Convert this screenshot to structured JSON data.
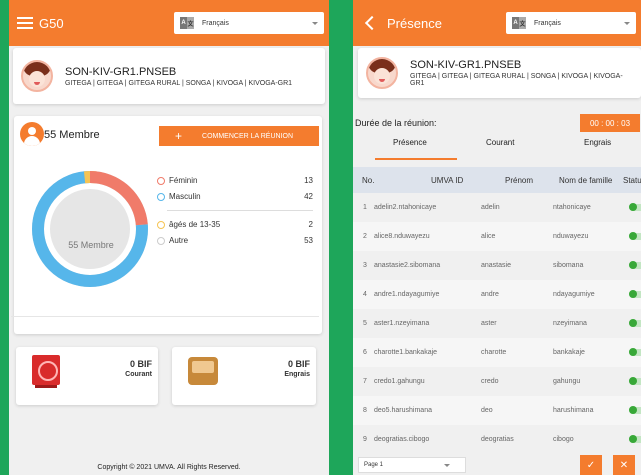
{
  "left": {
    "appbar_title": "G50",
    "language": "Français",
    "lang_badge": [
      "A",
      "文"
    ],
    "profile": {
      "name": "SON-KIV-GR1.PNSEB",
      "location": "GITEGA | GITEGA | GITEGA RURAL | SONGA | KIVOGA | KIVOGA-GR1"
    },
    "members": {
      "count_label": "55 Membre",
      "start_button": "COMMENCER LA RÉUNION",
      "plus": "+",
      "donut_center": "55 Membre",
      "legend": [
        {
          "label": "Féminin",
          "value": "13",
          "color": "#f07b6a"
        },
        {
          "label": "Masculin",
          "value": "42",
          "color": "#56b6ea"
        },
        {
          "label": "âgés de 13-35",
          "value": "2",
          "color": "#f6c453"
        },
        {
          "label": "Autre",
          "value": "53",
          "color": "#cccccc"
        }
      ]
    },
    "stats": [
      {
        "value": "0 BIF",
        "label": "Courant",
        "icon": "safe-icon"
      },
      {
        "value": "0 BIF",
        "label": "Engrais",
        "icon": "sack-icon"
      }
    ],
    "copyright": "Copyright © 2021 UMVA. All Rights Reserved."
  },
  "right": {
    "appbar_title": "Présence",
    "language": "Français",
    "lang_badge": [
      "A",
      "文"
    ],
    "profile": {
      "name": "SON-KIV-GR1.PNSEB",
      "location": "GITEGA | GITEGA | GITEGA RURAL | SONGA | KIVOGA | KIVOGA-GR1"
    },
    "meeting_label": "Durée de la réunion:",
    "timer": "00 : 00 : 03",
    "tabs": [
      "Présence",
      "Courant",
      "Engrais"
    ],
    "table_headers": {
      "no": "No.",
      "umva": "UMVA ID",
      "prenom": "Prénom",
      "nom": "Nom de famille",
      "statut": "Statut"
    },
    "rows": [
      {
        "no": "1",
        "umva": "adelin2.ntahonicaye",
        "prenom": "adelin",
        "nom": "ntahonicaye"
      },
      {
        "no": "2",
        "umva": "alice8.nduwayezu",
        "prenom": "alice",
        "nom": "nduwayezu"
      },
      {
        "no": "3",
        "umva": "anastasie2.sibomana",
        "prenom": "anastasie",
        "nom": "sibomana"
      },
      {
        "no": "4",
        "umva": "andre1.ndayagumiye",
        "prenom": "andre",
        "nom": "ndayagumiye"
      },
      {
        "no": "5",
        "umva": "aster1.nzeyimana",
        "prenom": "aster",
        "nom": "nzeyimana"
      },
      {
        "no": "6",
        "umva": "charotte1.bankakaje",
        "prenom": "charotte",
        "nom": "bankakaje"
      },
      {
        "no": "7",
        "umva": "credo1.gahungu",
        "prenom": "credo",
        "nom": "gahungu"
      },
      {
        "no": "8",
        "umva": "deo5.harushimana",
        "prenom": "deo",
        "nom": "harushimana"
      },
      {
        "no": "9",
        "umva": "deogratias.cibogo",
        "prenom": "deogratias",
        "nom": "cibogo"
      }
    ],
    "page_select": "Page 1",
    "confirm_glyph": "✓",
    "close_glyph": "✕"
  }
}
